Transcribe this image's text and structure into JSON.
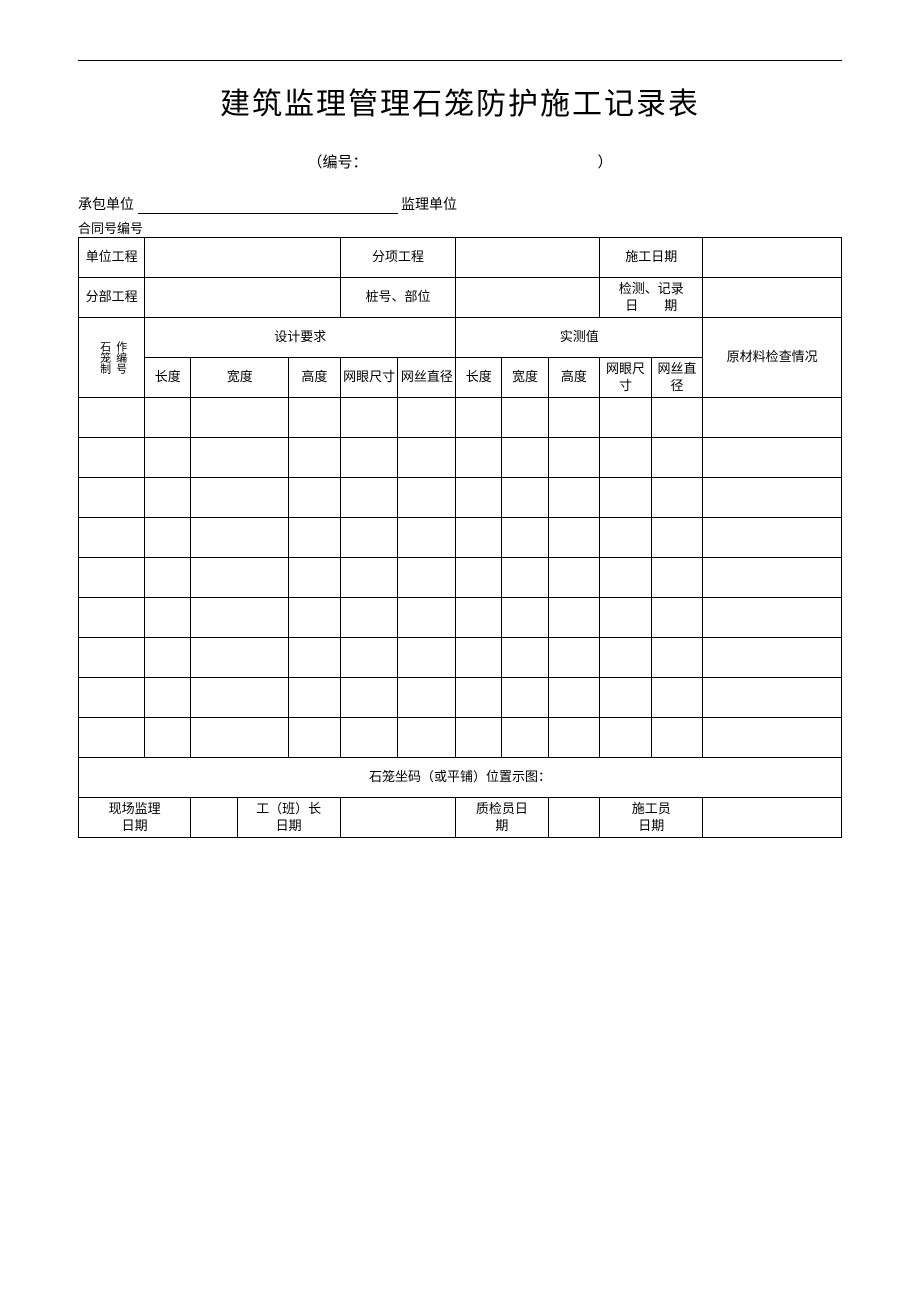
{
  "title": "建筑监理管理石笼防护施工记录表",
  "sub_left": "（编号：",
  "sub_right": "）",
  "meta": {
    "contractor_label": "承包单位",
    "supervisor_label": "监理单位",
    "contract_no_label": "合同号编号"
  },
  "row1": {
    "unit_proj": "单位工程",
    "sub_item_proj": "分项工程",
    "construct_date": "施工日期"
  },
  "row2": {
    "section_proj": "分部工程",
    "station": "桩号、部位",
    "check_date1": "检测、记录",
    "check_date2": "日　　期"
  },
  "colhead": {
    "cage_no_a": "石笼制",
    "cage_no_b": "作编号",
    "design_req": "设计要求",
    "measured": "实测值",
    "material": "原材料检查情况",
    "len": "长度",
    "wid": "宽度",
    "hei": "高度",
    "mesh": "网眼尺寸",
    "wire": "网丝直径"
  },
  "diagram_label": "石笼坐码（或平铺）位置示图：",
  "sig": {
    "site_sup": "现场监理",
    "site_sup_date": "日期",
    "foreman": "工（班）长",
    "foreman_date": "日期",
    "qc": "质检员日",
    "qc_date": "期",
    "builder": "施工员",
    "builder_date": "日期"
  }
}
